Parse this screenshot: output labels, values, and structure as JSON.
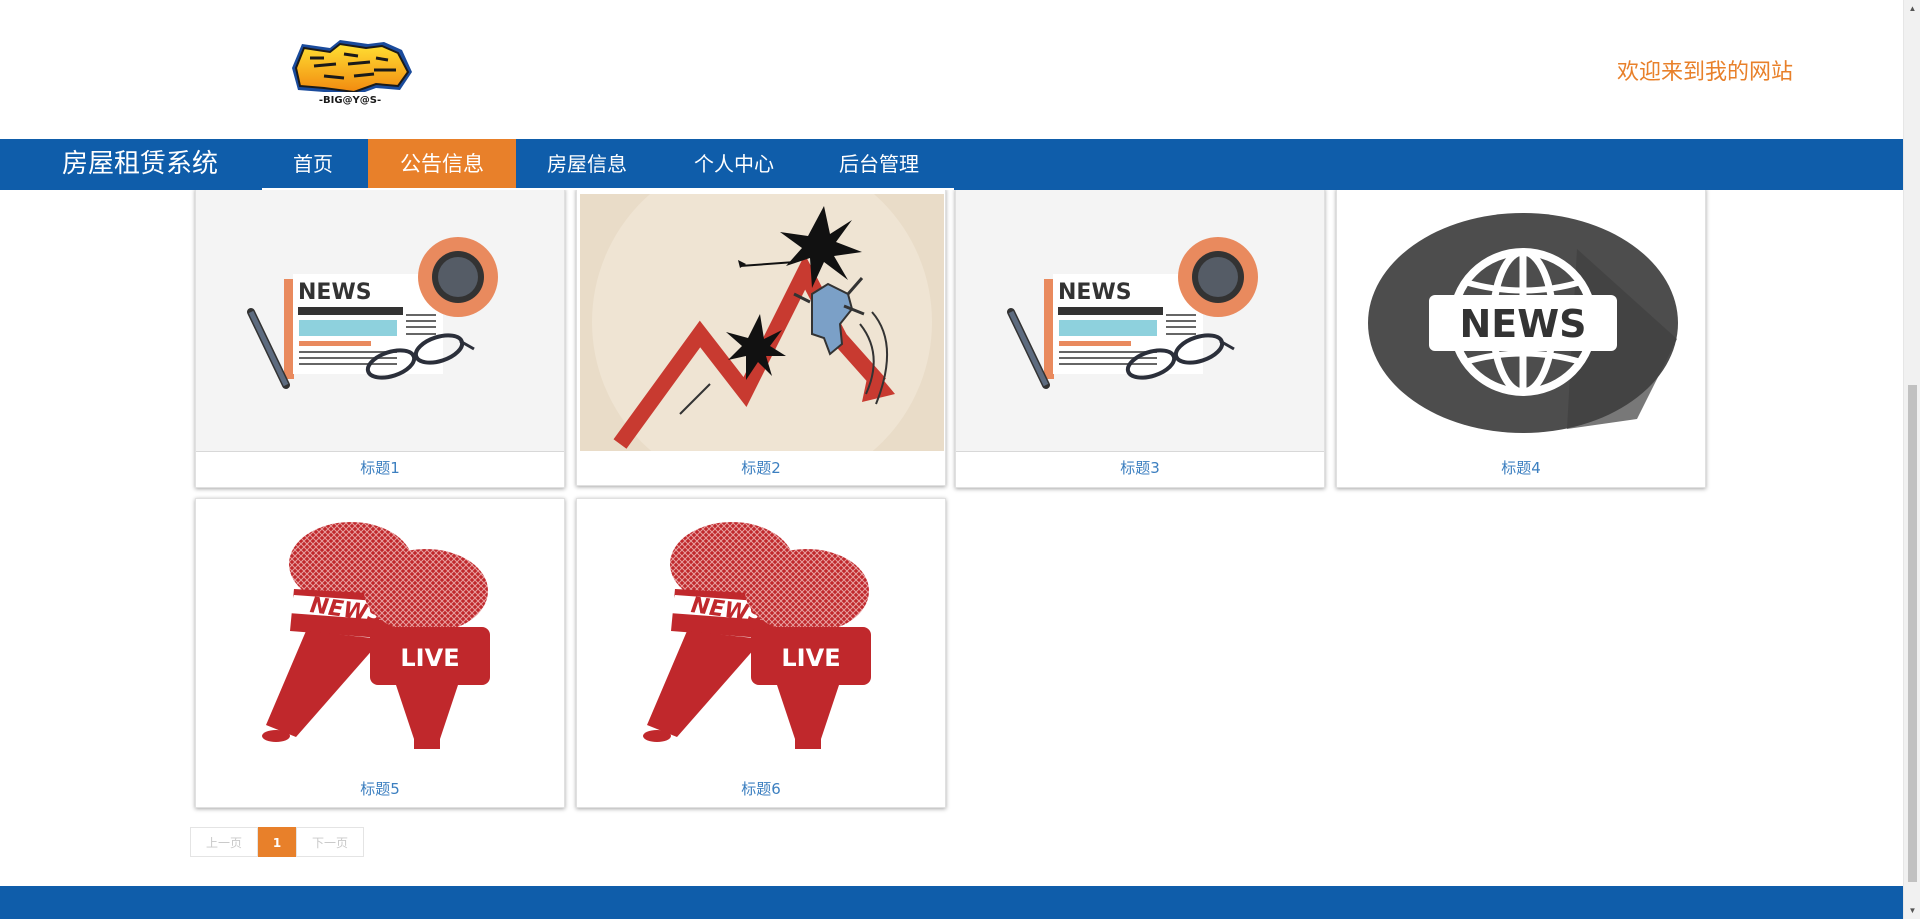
{
  "header": {
    "welcome_text": "欢迎来到我的网站",
    "logo_alt": "BIG@Y@S"
  },
  "nav": {
    "brand": "房屋租赁系统",
    "items": [
      {
        "label": "首页",
        "active": false
      },
      {
        "label": "公告信息",
        "active": true
      },
      {
        "label": "房屋信息",
        "active": false
      },
      {
        "label": "个人中心",
        "active": false
      },
      {
        "label": "后台管理",
        "active": false
      }
    ]
  },
  "cards": [
    {
      "title": "标题1",
      "image": "news-paper-icon"
    },
    {
      "title": "标题2",
      "image": "falling-chart-icon"
    },
    {
      "title": "标题3",
      "image": "news-paper-icon"
    },
    {
      "title": "标题4",
      "image": "news-globe-icon"
    },
    {
      "title": "标题5",
      "image": "news-microphone-icon"
    },
    {
      "title": "标题6",
      "image": "news-microphone-icon"
    }
  ],
  "pagination": {
    "prev_label": "上一页",
    "current_page": "1",
    "next_label": "下一页"
  },
  "colors": {
    "nav_blue": "#0f5daa",
    "accent_orange": "#e8802a",
    "title_blue": "#3c7fc0"
  }
}
